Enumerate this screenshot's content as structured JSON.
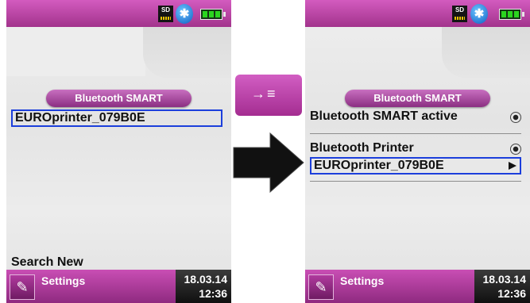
{
  "left_screen": {
    "header_title": "Bluetooth SMART",
    "items": [
      {
        "label": "EUROprinter_079B0E",
        "selected": true
      }
    ],
    "bottom_action": "Search New",
    "footer": {
      "label": "Settings",
      "date": "18.03.14",
      "time": "12:36"
    },
    "status_icons": [
      "sd-card-icon",
      "bluetooth-icon",
      "battery-icon"
    ],
    "sd_label": "SD",
    "bluetooth_glyph": "✱"
  },
  "right_screen": {
    "header_title": "Bluetooth SMART",
    "items": [
      {
        "label": "Bluetooth SMART active",
        "control": "radio"
      },
      {
        "label": "Bluetooth Printer",
        "control": "radio"
      },
      {
        "label": "EUROprinter_079B0E",
        "control": "arrow",
        "selected": true
      }
    ],
    "footer": {
      "label": "Settings",
      "date": "18.03.14",
      "time": "12:36"
    },
    "sd_label": "SD",
    "bluetooth_glyph": "✱"
  },
  "middle": {
    "button_icon": "→≡",
    "button_icon_name": "print-arrow-icon",
    "arrow_icon_name": "right-arrow-icon"
  },
  "colors": {
    "accent_magenta": "#b33c9f",
    "selection_blue": "#1c3fdc",
    "battery_green": "#2bd51f",
    "bluetooth_blue": "#0d5fc4"
  }
}
